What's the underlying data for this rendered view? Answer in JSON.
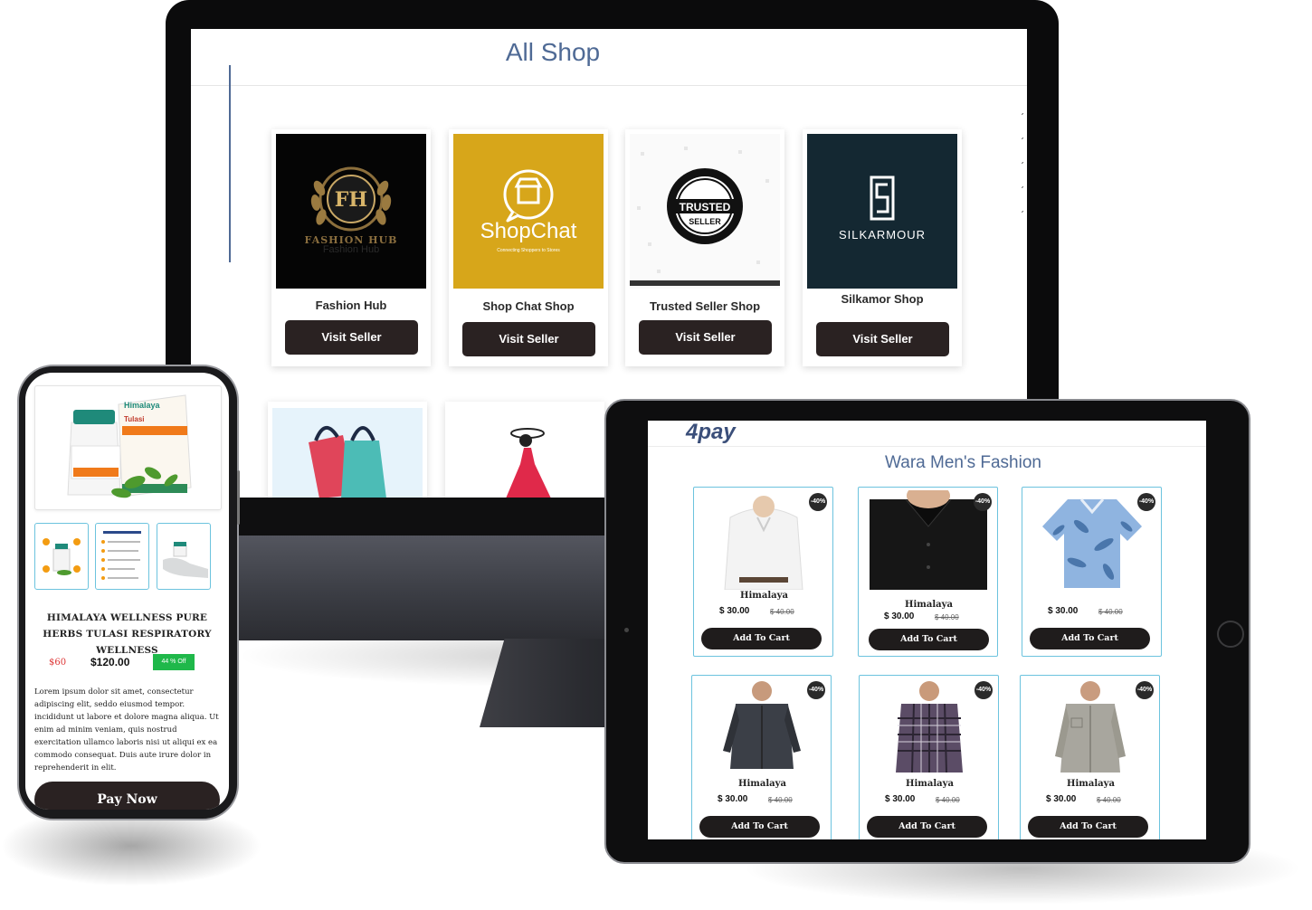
{
  "monitor": {
    "title": "All Shop",
    "shops": [
      {
        "name": "Fashion Hub",
        "logo_text": "FASHION HUB",
        "logo_sub": "Fashion Hub",
        "button": "Visit Seller"
      },
      {
        "name": "Shop Chat Shop",
        "logo_text": "ShopChat",
        "logo_sub": "Connecting Shoppers to Stores",
        "button": "Visit Seller"
      },
      {
        "name": "Trusted Seller Shop",
        "logo_text": "TRUSTED",
        "logo_sub": "SELLER",
        "button": "Visit Seller"
      },
      {
        "name": "Silkamor Shop",
        "logo_text": "SILKARMOUR",
        "logo_sub": "",
        "button": "Visit Seller"
      }
    ]
  },
  "tablet": {
    "logo": "4pay",
    "title": "Wara Men's Fashion",
    "products": [
      {
        "brand": "Himalaya",
        "price": "$ 30.00",
        "old_price": "$ 40.00",
        "discount": "-40%",
        "button": "Add To Cart",
        "shirt_color": "#f4f4f4"
      },
      {
        "brand": "Himalaya",
        "price": "$ 30.00",
        "old_price": "$ 40.00",
        "discount": "-40%",
        "button": "Add To Cart",
        "shirt_color": "#1a1a1a"
      },
      {
        "brand": "Himalaya",
        "price": "$ 30.00",
        "old_price": "$ 40.00",
        "discount": "-40%",
        "button": "Add To Cart",
        "shirt_color": "#6f9bd2"
      },
      {
        "brand": "Himalaya",
        "price": "$ 30.00",
        "old_price": "$ 40.00",
        "discount": "-40%",
        "button": "Add To Cart",
        "shirt_color": "#3b3f47"
      },
      {
        "brand": "Himalaya",
        "price": "$ 30.00",
        "old_price": "$ 40.00",
        "discount": "-40%",
        "button": "Add To Cart",
        "shirt_color": "#5b4c66"
      },
      {
        "brand": "Himalaya",
        "price": "$ 30.00",
        "old_price": "$ 40.00",
        "discount": "-40%",
        "button": "Add To Cart",
        "shirt_color": "#a8a69e"
      }
    ]
  },
  "phone": {
    "product_title": "HIMALAYA WELLNESS PURE HERBS TULASI RESPIRATORY WELLNESS",
    "old_price": "$60",
    "price": "$120.00",
    "discount": "44 % Off",
    "description": "Lorem ipsum dolor sit amet, consectetur adipiscing elit, seddo eiusmod tempor. incididunt ut labore et dolore magna aliqua. Ut enim ad minim veniam, quis nostrud exercitation ullamco laboris nisi ut aliqui ex ea commodo consequat. Duis aute irure dolor in reprehenderit in elit.",
    "pay_button": "Pay Now",
    "package_brand": "Himalaya",
    "package_name": "Tulasi"
  },
  "colors": {
    "accent": "#4f6a95",
    "button": "#2a2222",
    "card_border": "#6cc3de",
    "discount_green": "#1fb84a"
  }
}
